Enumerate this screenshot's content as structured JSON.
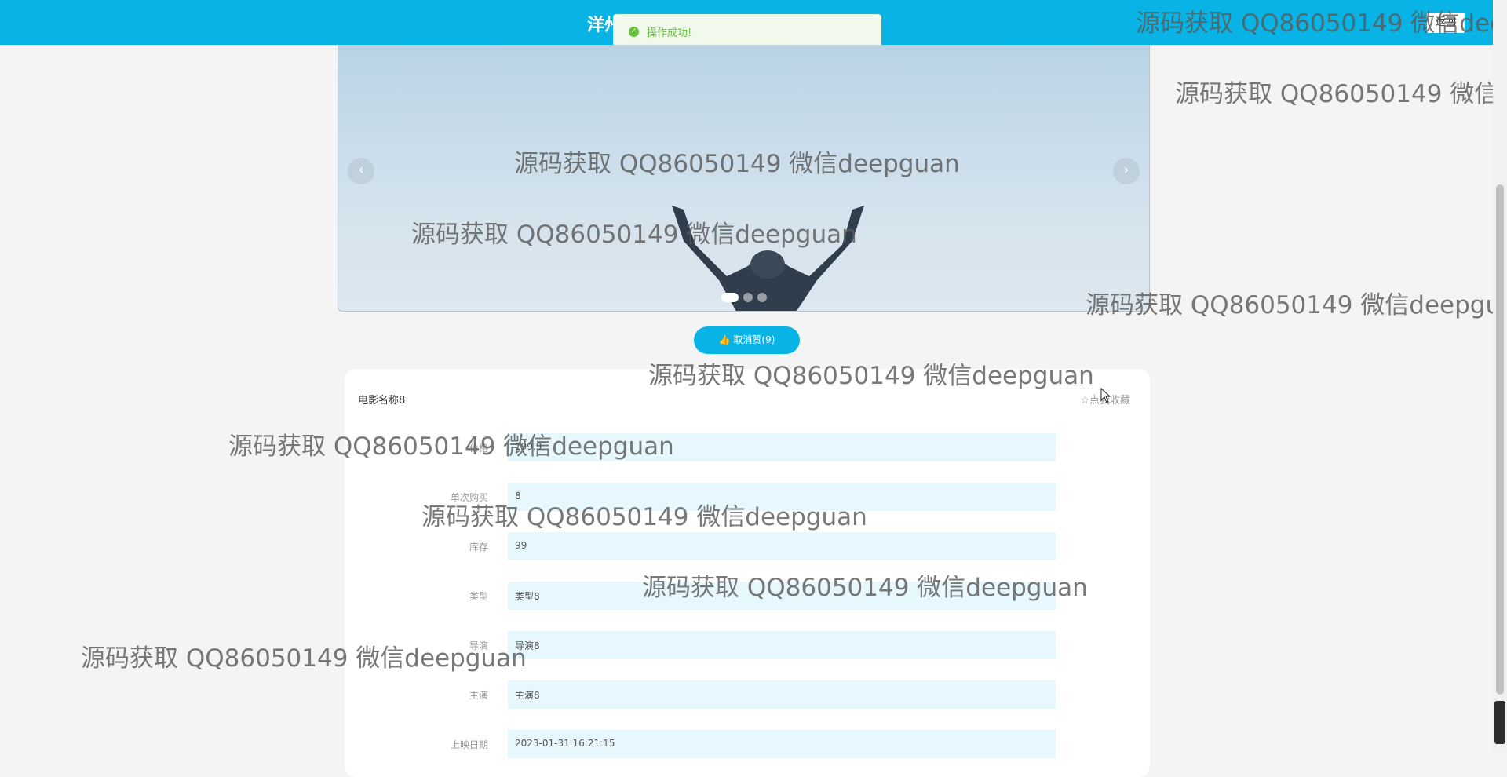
{
  "header": {
    "title": "洋州",
    "back_label": "返回"
  },
  "toast": {
    "message": "操作成功!"
  },
  "carousel": {
    "prev": "‹",
    "next": "›",
    "slide_count": 3,
    "active_slide": 1
  },
  "like_button": {
    "label": "取消赞(9)"
  },
  "detail": {
    "name": "电影名称8",
    "favorite_label": "☆点我收藏",
    "fields": [
      {
        "label": "价格",
        "value": "199.9"
      },
      {
        "label": "单次购买",
        "value": "8"
      },
      {
        "label": "库存",
        "value": "99"
      },
      {
        "label": "类型",
        "value": "类型8"
      },
      {
        "label": "导演",
        "value": "导演8"
      },
      {
        "label": "主演",
        "value": "主演8"
      },
      {
        "label": "上映日期",
        "value": "2023-01-31 16:21:15"
      }
    ]
  },
  "watermark": "源码获取 QQ86050149 微信deepguan",
  "colors": {
    "brand": "#08b4e6",
    "success": "#67c23a",
    "field_bg": "#e6f7fd"
  }
}
